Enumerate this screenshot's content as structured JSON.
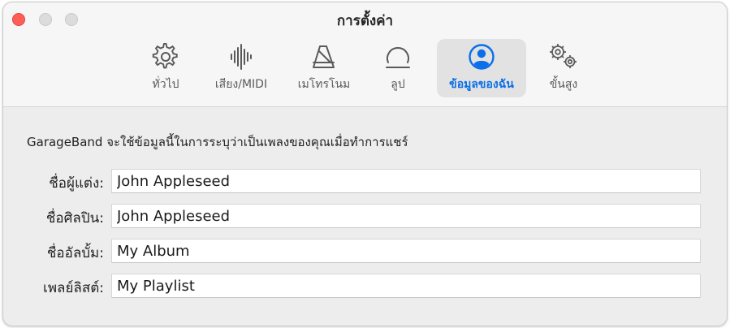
{
  "window": {
    "title": "การตั้งค่า"
  },
  "tabs": [
    {
      "id": "general",
      "label": "ทั่วไป",
      "icon": "gear-icon",
      "active": false
    },
    {
      "id": "audio",
      "label": "เสียง/MIDI",
      "icon": "waveform-icon",
      "active": false
    },
    {
      "id": "metronome",
      "label": "เมโทรโนม",
      "icon": "metronome-icon",
      "active": false
    },
    {
      "id": "loops",
      "label": "ลูป",
      "icon": "loop-icon",
      "active": false
    },
    {
      "id": "my-info",
      "label": "ข้อมูลของฉัน",
      "icon": "person-circle-icon",
      "active": true
    },
    {
      "id": "advanced",
      "label": "ขั้นสูง",
      "icon": "gears-icon",
      "active": false
    }
  ],
  "content": {
    "description": "GarageBand จะใช้ข้อมูลนี้ในการระบุว่าเป็นเพลงของคุณเมื่อทำการแชร์",
    "fields": [
      {
        "label": "ชื่อผู้แต่ง:",
        "value": "John Appleseed"
      },
      {
        "label": "ชื่อศิลปิน:",
        "value": "John Appleseed"
      },
      {
        "label": "ชื่ออัลบั้ม:",
        "value": "My Album"
      },
      {
        "label": "เพลย์ลิสต์:",
        "value": "My Playlist"
      }
    ]
  },
  "colors": {
    "accent": "#0a6fe8",
    "close": "#ff5f57",
    "inactive_button": "#dcdcdc"
  }
}
